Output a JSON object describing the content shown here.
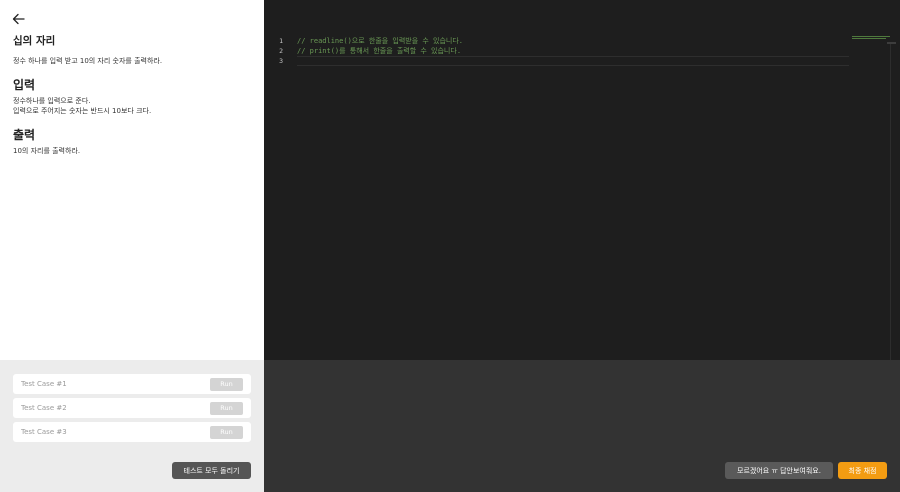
{
  "problem": {
    "title": "십의 자리",
    "description": "정수 하나를 입력 받고 10의 자리 숫자를 출력하라.",
    "input_heading": "입력",
    "input_lines": [
      "정수하나를 입력으로 준다.",
      "입력으로 주어지는 숫자는 반드시 10보다 크다."
    ],
    "output_heading": "출력",
    "output_line": "10의 자리를 출력하라."
  },
  "test_cases": [
    {
      "label": "Test Case #1",
      "run_label": "Run"
    },
    {
      "label": "Test Case #2",
      "run_label": "Run"
    },
    {
      "label": "Test Case #3",
      "run_label": "Run"
    }
  ],
  "buttons": {
    "listen_all": "테스트 모두 돌리기",
    "dont_know": "모르겠어요 ㅠ 답안보여줘요.",
    "submit": "최종 채점"
  },
  "editor": {
    "line_numbers": [
      "1",
      "2",
      "3"
    ],
    "lines": [
      "// readline()으로 한줄을 입력받을 수 있습니다.",
      "// print()를 통해서 한줄을 출력할 수 있습니다.",
      ""
    ]
  },
  "colors": {
    "editor_bg": "#1e1e1e",
    "comment": "#6a9955",
    "submit_accent": "#f39c12",
    "output_bg": "#333333"
  }
}
